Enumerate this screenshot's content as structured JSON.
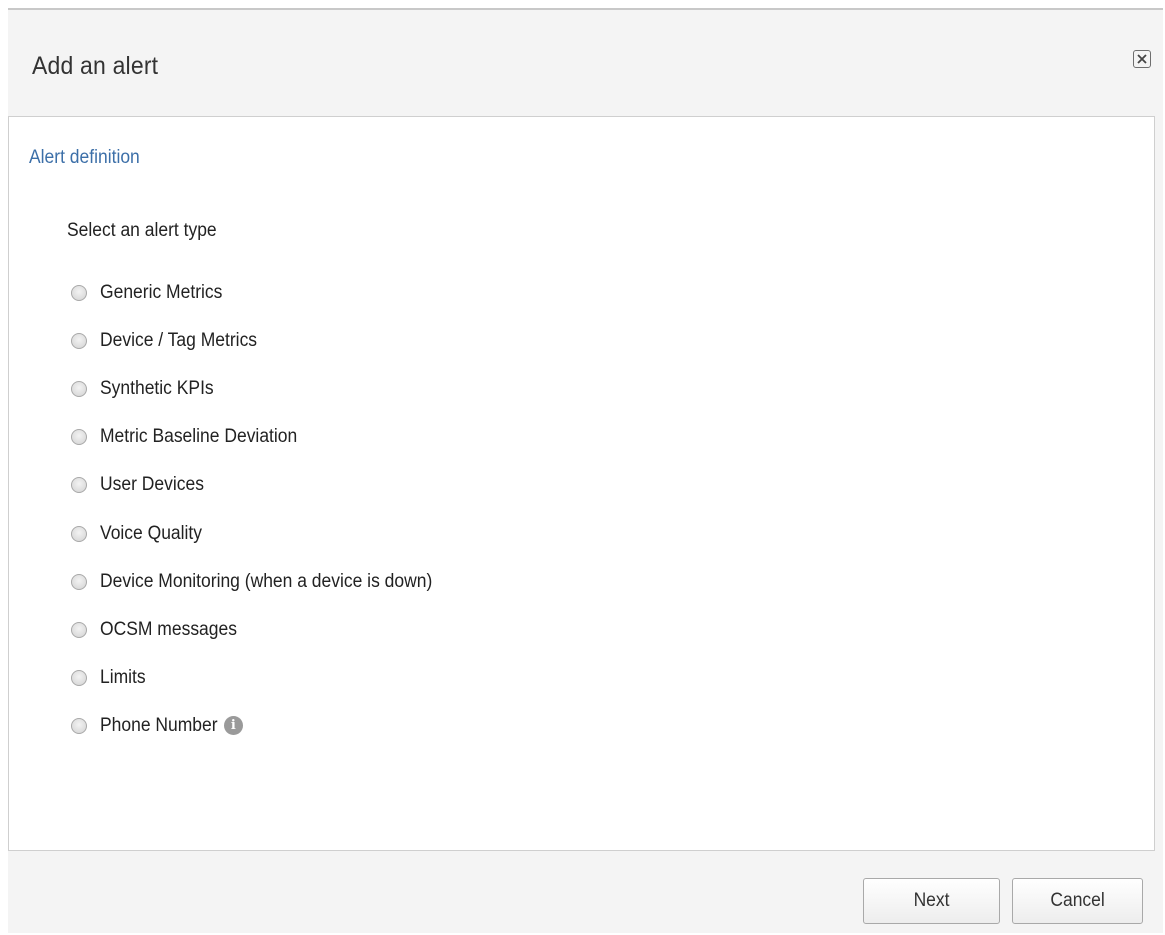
{
  "dialog": {
    "title": "Add an alert",
    "close_icon": "close-icon"
  },
  "section": {
    "title": "Alert definition",
    "prompt": "Select an alert type"
  },
  "alert_types": [
    {
      "label": "Generic Metrics",
      "selected": false
    },
    {
      "label": "Device / Tag Metrics",
      "selected": false
    },
    {
      "label": "Synthetic KPIs",
      "selected": false
    },
    {
      "label": "Metric Baseline Deviation",
      "selected": false
    },
    {
      "label": "User Devices",
      "selected": false
    },
    {
      "label": "Voice Quality",
      "selected": false
    },
    {
      "label": "Device Monitoring (when a device is down)",
      "selected": false
    },
    {
      "label": "OCSM messages",
      "selected": false
    },
    {
      "label": "Limits",
      "selected": false
    },
    {
      "label": "Phone Number",
      "selected": false,
      "info_icon": "info-icon",
      "info_glyph": "i"
    }
  ],
  "footer": {
    "next_label": "Next",
    "cancel_label": "Cancel"
  },
  "colors": {
    "section_title": "#3c6fa8",
    "panel_background": "#f4f4f4",
    "info_icon": "#9a9a9a"
  }
}
